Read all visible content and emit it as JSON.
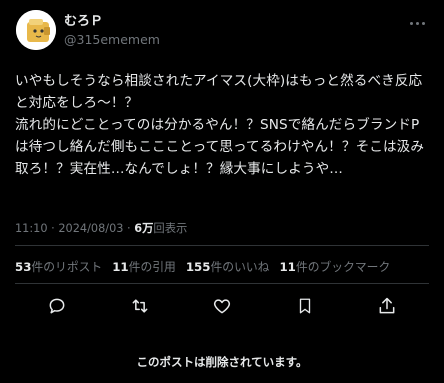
{
  "author": {
    "display_name": "むろＰ",
    "handle": "@315ememem"
  },
  "tweet": {
    "text": "いやもしそうなら相談されたアイマス(大枠)はもっと然るべき反応と対応をしろ〜！？\n流れ的にどことってのは分かるやん！？SNSで絡んだらブランドPは待つし絡んだ側もここことって思ってるわけやん！？そこは汲み取ろ！？実在性…なんでしょ！？縁大事にしようや…",
    "time": "11:10 · 2024/08/03 · ",
    "views_count": "6万",
    "views_label": "回表示"
  },
  "stats": {
    "reposts_count": "53",
    "reposts_label": "件のリポスト",
    "quotes_count": "11",
    "quotes_label": "件の引用",
    "likes_count": "155",
    "likes_label": "件のいいね",
    "bookmarks_count": "11",
    "bookmarks_label": "件のブックマーク"
  },
  "footer": {
    "deleted_notice": "このポストは削除されています。"
  },
  "icons": [
    "reply-icon",
    "repost-icon",
    "like-icon",
    "bookmark-icon",
    "share-icon",
    "more-icon"
  ],
  "colors": {
    "background": "#000000",
    "text": "#e7e9ea",
    "muted": "#71767b",
    "border": "#2f3336"
  }
}
